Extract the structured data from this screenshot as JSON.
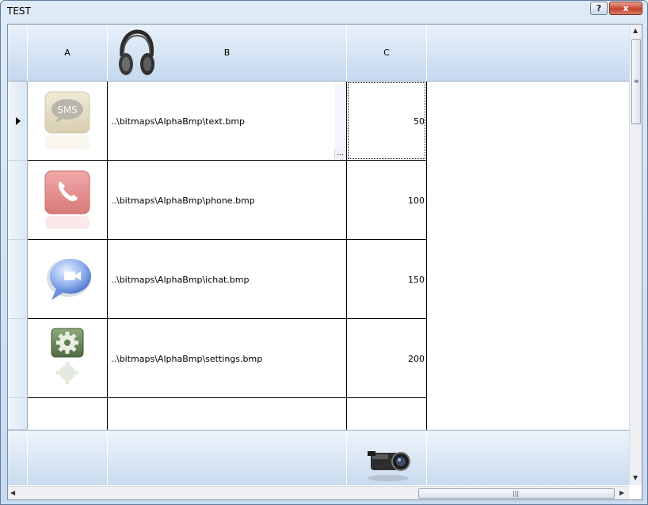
{
  "window": {
    "title": "TEST",
    "help_label": "?",
    "close_label": "x"
  },
  "columns": [
    {
      "label": "A"
    },
    {
      "label": "B"
    },
    {
      "label": "C"
    }
  ],
  "rows": [
    {
      "icon": "sms-icon",
      "icon_text": "SMS",
      "path": "..\\bitmaps\\AlphaBmp\\text.bmp",
      "value": "50"
    },
    {
      "icon": "phone-icon",
      "path": "..\\bitmaps\\AlphaBmp\\phone.bmp",
      "value": "100"
    },
    {
      "icon": "ichat-icon",
      "path": "..\\bitmaps\\AlphaBmp\\ichat.bmp",
      "value": "150"
    },
    {
      "icon": "settings-icon",
      "path": "..\\bitmaps\\AlphaBmp\\settings.bmp",
      "value": "200"
    }
  ],
  "ellipsis": "...",
  "icons": {
    "header_b": "headphones-icon",
    "footer_c": "camcorder-icon",
    "row_selected": "row-pointer-icon"
  },
  "colors": {
    "header_top": "#e9f1fb",
    "header_bottom": "#c5d8ee",
    "close_button": "#c4432b"
  }
}
